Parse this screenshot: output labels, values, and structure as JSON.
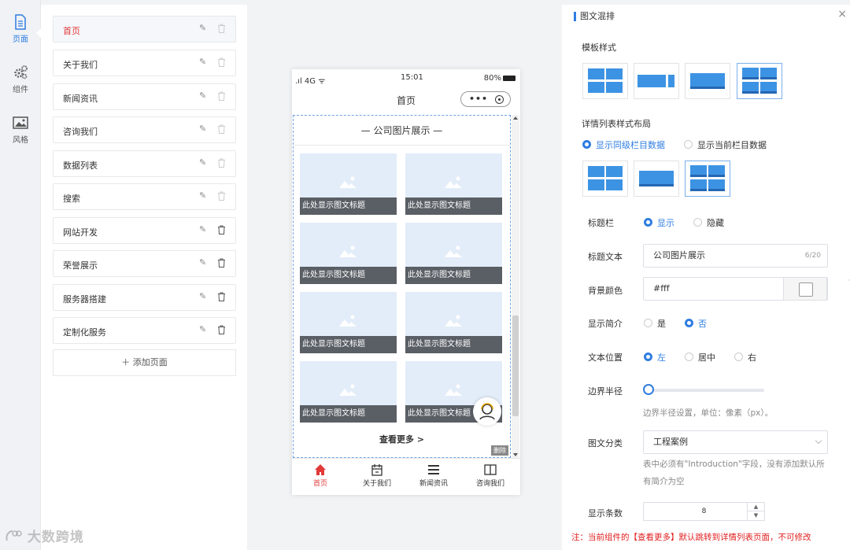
{
  "rail": {
    "items": [
      {
        "label": "页面",
        "icon": "page-icon"
      },
      {
        "label": "组件",
        "icon": "gears-icon"
      },
      {
        "label": "风格",
        "icon": "image-icon"
      }
    ]
  },
  "pages": {
    "items": [
      {
        "label": "首页"
      },
      {
        "label": "关于我们"
      },
      {
        "label": "新闻资讯"
      },
      {
        "label": "咨询我们"
      },
      {
        "label": "数据列表"
      },
      {
        "label": "搜索"
      },
      {
        "label": "网站开发"
      },
      {
        "label": "荣誉展示"
      },
      {
        "label": "服务器搭建"
      },
      {
        "label": "定制化服务"
      }
    ],
    "add_label": "＋ 添加页面"
  },
  "phone": {
    "signal": ".ıl 4G ᯤ",
    "time": "15:01",
    "battery": "80%",
    "nav_title": "首页",
    "capsule_dots": "•••",
    "module_title": "— 公司图片展示 —",
    "card_caption": "此处显示图文标题",
    "more": "查看更多 >",
    "delete_tag": "删除",
    "tabs": [
      {
        "label": "首页",
        "icon": "home-icon"
      },
      {
        "label": "关于我们",
        "icon": "calendar-icon"
      },
      {
        "label": "新闻资讯",
        "icon": "menu-icon"
      },
      {
        "label": "咨询我们",
        "icon": "book-icon"
      }
    ]
  },
  "panel": {
    "title": "图文混排",
    "close": "×",
    "template_style_label": "模板样式",
    "detail_layout_label": "详情列表样式布局",
    "radio_same_level": "显示同级栏目数据",
    "radio_current": "显示当前栏目数据",
    "title_bar_label": "标题栏",
    "title_bar_show": "显示",
    "title_bar_hide": "隐藏",
    "title_text_label": "标题文本",
    "title_text_value": "公司图片展示",
    "title_text_count": "6/20",
    "bg_color_label": "背景颜色",
    "bg_color_value": "#fff",
    "show_intro_label": "显示简介",
    "show_intro_yes": "是",
    "show_intro_no": "否",
    "text_pos_label": "文本位置",
    "text_pos_left": "左",
    "text_pos_center": "居中",
    "text_pos_right": "右",
    "radius_label": "边界半径",
    "radius_hint": "边界半径设置，单位：像素（px）。",
    "category_label": "图文分类",
    "category_value": "工程案例",
    "category_hint_1": "表中必须有\"Introduction\"字段，没有添加默认所",
    "category_hint_2": "有简介为空",
    "count_label": "显示条数",
    "count_value": "8",
    "warning": "注：当前组件的【查看更多】默认跳转到详情列表页面，不可修改"
  },
  "watermark": "大数跨境",
  "colors": {
    "accent": "#2f7de1",
    "active_red": "#e23a3a",
    "warning": "#e02020"
  }
}
